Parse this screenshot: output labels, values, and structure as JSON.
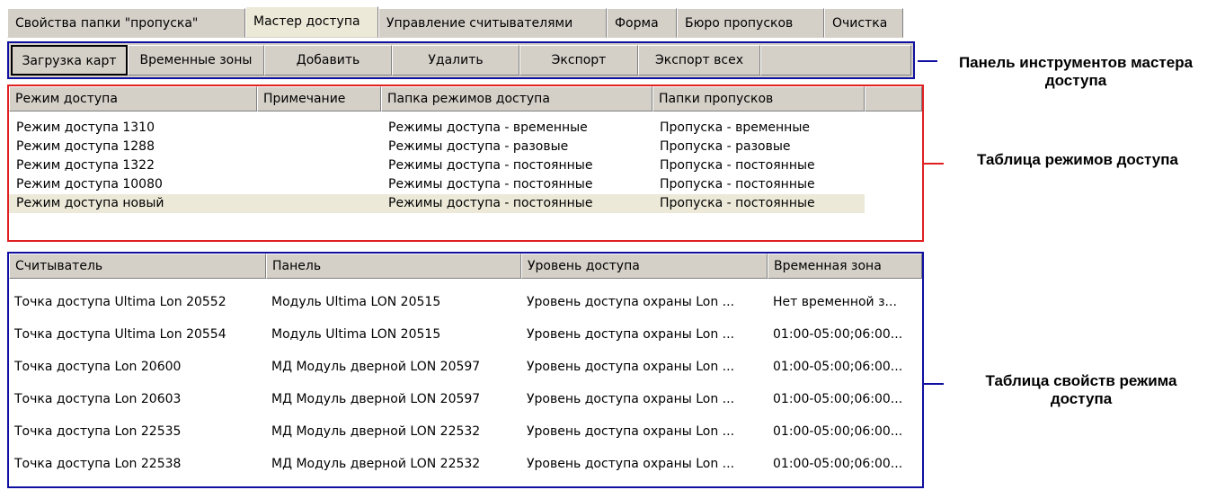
{
  "tabs": [
    "Свойства папки \"пропуска\"",
    "Мастер доступа",
    "Управление считывателями",
    "Форма",
    "Бюро пропусков",
    "Очистка"
  ],
  "active_tab": "Мастер доступа",
  "toolbar": {
    "buttons": [
      "Загрузка карт",
      "Временные зоны",
      "Добавить",
      "Удалить",
      "Экспорт",
      "Экспорт всех"
    ]
  },
  "modes_table": {
    "columns": [
      "Режим доступа",
      "Примечание",
      "Папка режимов доступа",
      "Папки пропусков"
    ],
    "rows": [
      [
        "Режим доступа 1310",
        "",
        "Режимы доступа - временные",
        "Пропуска - временные"
      ],
      [
        "Режим доступа 1288",
        "",
        "Режимы доступа - разовые",
        "Пропуска - разовые"
      ],
      [
        "Режим доступа 1322",
        "",
        "Режимы доступа - постоянные",
        "Пропуска - постоянные"
      ],
      [
        "Режим доступа 10080",
        "",
        "Режимы доступа - постоянные",
        "Пропуска - постоянные"
      ],
      [
        "Режим доступа новый",
        "",
        "Режимы доступа - постоянные",
        "Пропуска - постоянные"
      ]
    ],
    "selected_row": 4
  },
  "props_table": {
    "columns": [
      "Считыватель",
      "Панель",
      "Уровень доступа",
      "Временная зона"
    ],
    "rows": [
      [
        "Точка доступа Ultima Lon 20552",
        "Модуль Ultima LON 20515",
        "Уровень доступа охраны Lon ...",
        "Нет временной з..."
      ],
      [
        "Точка доступа Ultima Lon 20554",
        "Модуль Ultima LON 20515",
        "Уровень доступа охраны Lon ...",
        "01:00-05:00;06:00..."
      ],
      [
        "Точка доступа Lon 20600",
        "МД Модуль дверной LON 20597",
        "Уровень доступа охраны Lon ...",
        "01:00-05:00;06:00..."
      ],
      [
        "Точка доступа Lon 20603",
        "МД Модуль дверной LON 20597",
        "Уровень доступа охраны Lon ...",
        "01:00-05:00;06:00..."
      ],
      [
        "Точка доступа Lon 22535",
        "МД Модуль дверной LON 22532",
        "Уровень доступа охраны Lon ...",
        "01:00-05:00;06:00..."
      ],
      [
        "Точка доступа Lon 22538",
        "МД Модуль дверной LON 22532",
        "Уровень доступа охраны Lon ...",
        "01:00-05:00;06:00..."
      ]
    ]
  },
  "annotations": {
    "toolbar_note": "Панель инструментов мастера доступа",
    "modes_note": "Таблица режимов доступа",
    "props_note": "Таблица свойств режима доступа"
  },
  "colors": {
    "blue_frame": "#1010a0",
    "red_frame": "#e02020",
    "window_bg": "#d4d0c8"
  }
}
